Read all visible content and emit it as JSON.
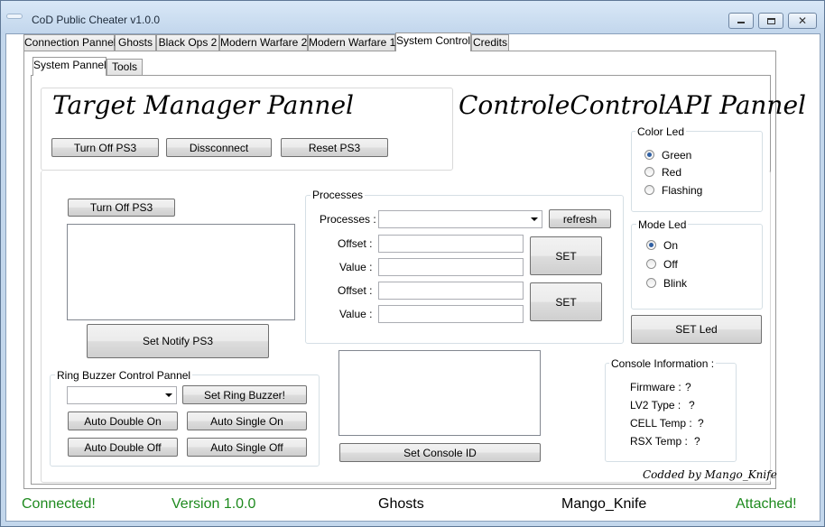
{
  "window": {
    "title": "CoD Public Cheater v1.0.0",
    "controls": [
      "minimize",
      "maximize",
      "close"
    ]
  },
  "main_tabs": [
    {
      "label": "Connection Pannel",
      "active": false
    },
    {
      "label": "Ghosts",
      "active": false
    },
    {
      "label": "Black Ops 2",
      "active": false
    },
    {
      "label": "Modern Warfare 2",
      "active": false
    },
    {
      "label": "Modern Warfare 1",
      "active": false
    },
    {
      "label": "System Control",
      "active": true
    },
    {
      "label": "Credits",
      "active": false
    }
  ],
  "sub_tabs": [
    {
      "label": "System Pannel",
      "active": true
    },
    {
      "label": "Tools",
      "active": false
    }
  ],
  "target_manager": {
    "title": "Target Manager Pannel",
    "buttons": {
      "turn_off": "Turn Off PS3",
      "disconnect": "Dissconnect",
      "reset": "Reset PS3"
    }
  },
  "ccapi": {
    "title": "ControleControlAPI Pannel"
  },
  "notify": {
    "turn_off": "Turn Off PS3",
    "set_notify": "Set Notify PS3",
    "text": ""
  },
  "processes": {
    "group_label": "Processes",
    "select_label": "Processes :",
    "selected": "",
    "refresh": "refresh",
    "offset_label": "Offset :",
    "value_label": "Value :",
    "set_label": "SET",
    "rows": [
      {
        "offset": "",
        "value": ""
      },
      {
        "offset": "",
        "value": ""
      }
    ]
  },
  "color_led": {
    "label": "Color Led",
    "options": [
      {
        "label": "Green",
        "checked": true
      },
      {
        "label": "Red",
        "checked": false
      },
      {
        "label": "Flashing",
        "checked": false
      }
    ]
  },
  "mode_led": {
    "label": "Mode Led",
    "options": [
      {
        "label": "On",
        "checked": true
      },
      {
        "label": "Off",
        "checked": false
      },
      {
        "label": "Blink",
        "checked": false
      }
    ]
  },
  "set_led": "SET Led",
  "buzzer": {
    "label": "Ring Buzzer Control Pannel",
    "selected": "",
    "set_ring": "Set Ring Buzzer!",
    "double_on": "Auto Double On",
    "single_on": "Auto Single On",
    "double_off": "Auto Double Off",
    "single_off": "Auto Single Off"
  },
  "console_id": {
    "text": "",
    "button": "Set Console ID"
  },
  "console_info": {
    "label": "Console Information :",
    "rows": [
      {
        "key": "Firmware :",
        "value": "?"
      },
      {
        "key": "LV2 Type :",
        "value": "?"
      },
      {
        "key": "CELL Temp :",
        "value": "?"
      },
      {
        "key": "RSX Temp :",
        "value": "?"
      }
    ]
  },
  "footer_signature": "Codded by Mango_Knife",
  "status_bar": {
    "connected": "Connected!",
    "version": "Version 1.0.0",
    "game": "Ghosts",
    "author": "Mango_Knife",
    "attached": "Attached!"
  },
  "colors": {
    "status_green": "#1e8a1e",
    "window_frame": "#c3d7ec",
    "radio_dot": "#2f5fa3"
  }
}
